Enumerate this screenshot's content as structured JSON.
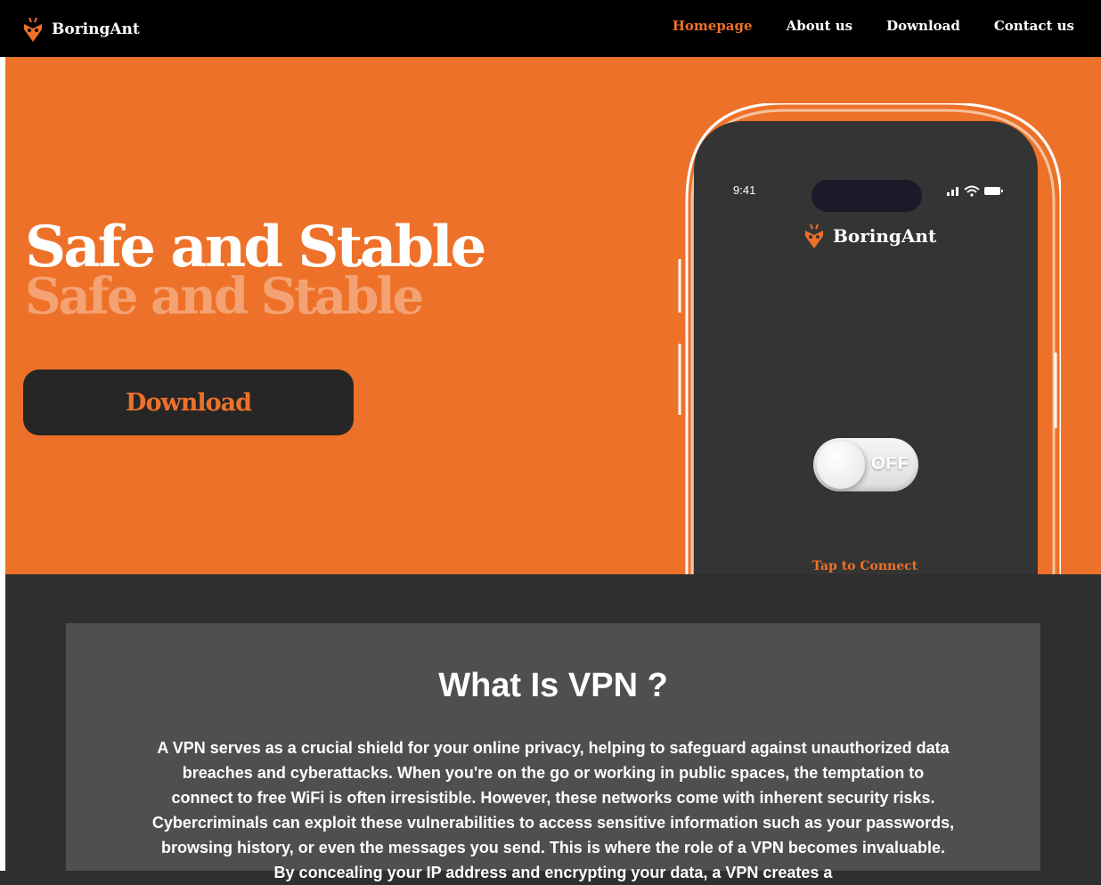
{
  "navbar": {
    "brand": "BoringAnt",
    "links": [
      {
        "label": "Homepage",
        "active": true
      },
      {
        "label": "About us",
        "active": false
      },
      {
        "label": "Download",
        "active": false
      },
      {
        "label": "Contact us",
        "active": false
      }
    ]
  },
  "hero": {
    "title": "Safe and Stable",
    "download_button": "Download"
  },
  "phone": {
    "status_time": "9:41",
    "brand": "BoringAnt",
    "toggle_state": "OFF",
    "tap_text": "Tap to Connect"
  },
  "content": {
    "title": "What Is VPN ?",
    "text": "A VPN serves as a crucial shield for your online privacy, helping to safeguard against unauthorized data breaches and cyberattacks. When you're on the go or working in public spaces, the temptation to connect to free WiFi is often irresistible. However, these networks come with inherent security risks. Cybercriminals can exploit these vulnerabilities to access sensitive information such as your passwords, browsing history, or even the messages you send. This is where the role of a VPN becomes invaluable. By concealing your IP address and encrypting your data, a VPN creates a"
  },
  "colors": {
    "accent": "#ee7129",
    "navbar": "#000000",
    "dark_background": "#2f2f2f",
    "panel": "#4f4f4f",
    "button": "#262626",
    "phone_screen": "#343434"
  },
  "icons": {
    "brand_logo": "ant-logo-icon",
    "signal": "cellular-signal-icon",
    "wifi": "wifi-icon",
    "battery": "battery-icon"
  }
}
